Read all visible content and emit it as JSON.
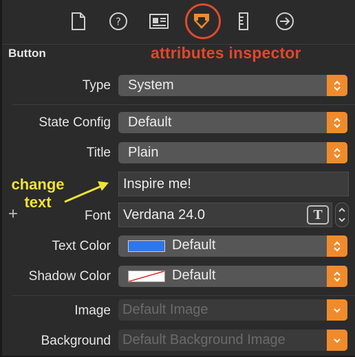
{
  "toolbar": {
    "icons": [
      "file-icon",
      "help-icon",
      "identity-icon",
      "attributes-icon",
      "ruler-icon",
      "connections-icon"
    ],
    "active_icon": "attributes-icon",
    "accent": "#f08b2c",
    "highlight_circle_color": "#e04a2d"
  },
  "section": {
    "title": "Button"
  },
  "annotations": {
    "inspector": "attributes inspector",
    "change_text": "change\ntext",
    "inspector_color": "#e5452c",
    "change_color": "#f0e334"
  },
  "fields": {
    "type": {
      "label": "Type",
      "value": "System"
    },
    "state_config": {
      "label": "State Config",
      "value": "Default"
    },
    "title_style": {
      "label": "Title",
      "value": "Plain"
    },
    "title_text": {
      "value": "Inspire me!"
    },
    "font": {
      "label": "Font",
      "value": "Verdana 24.0"
    },
    "text_color": {
      "label": "Text Color",
      "value": "Default",
      "swatch": "#2f76e8"
    },
    "shadow_color": {
      "label": "Shadow Color",
      "value": "Default"
    },
    "image": {
      "label": "Image",
      "placeholder": "Default Image"
    },
    "background": {
      "label": "Background",
      "placeholder": "Default Background Image"
    }
  }
}
